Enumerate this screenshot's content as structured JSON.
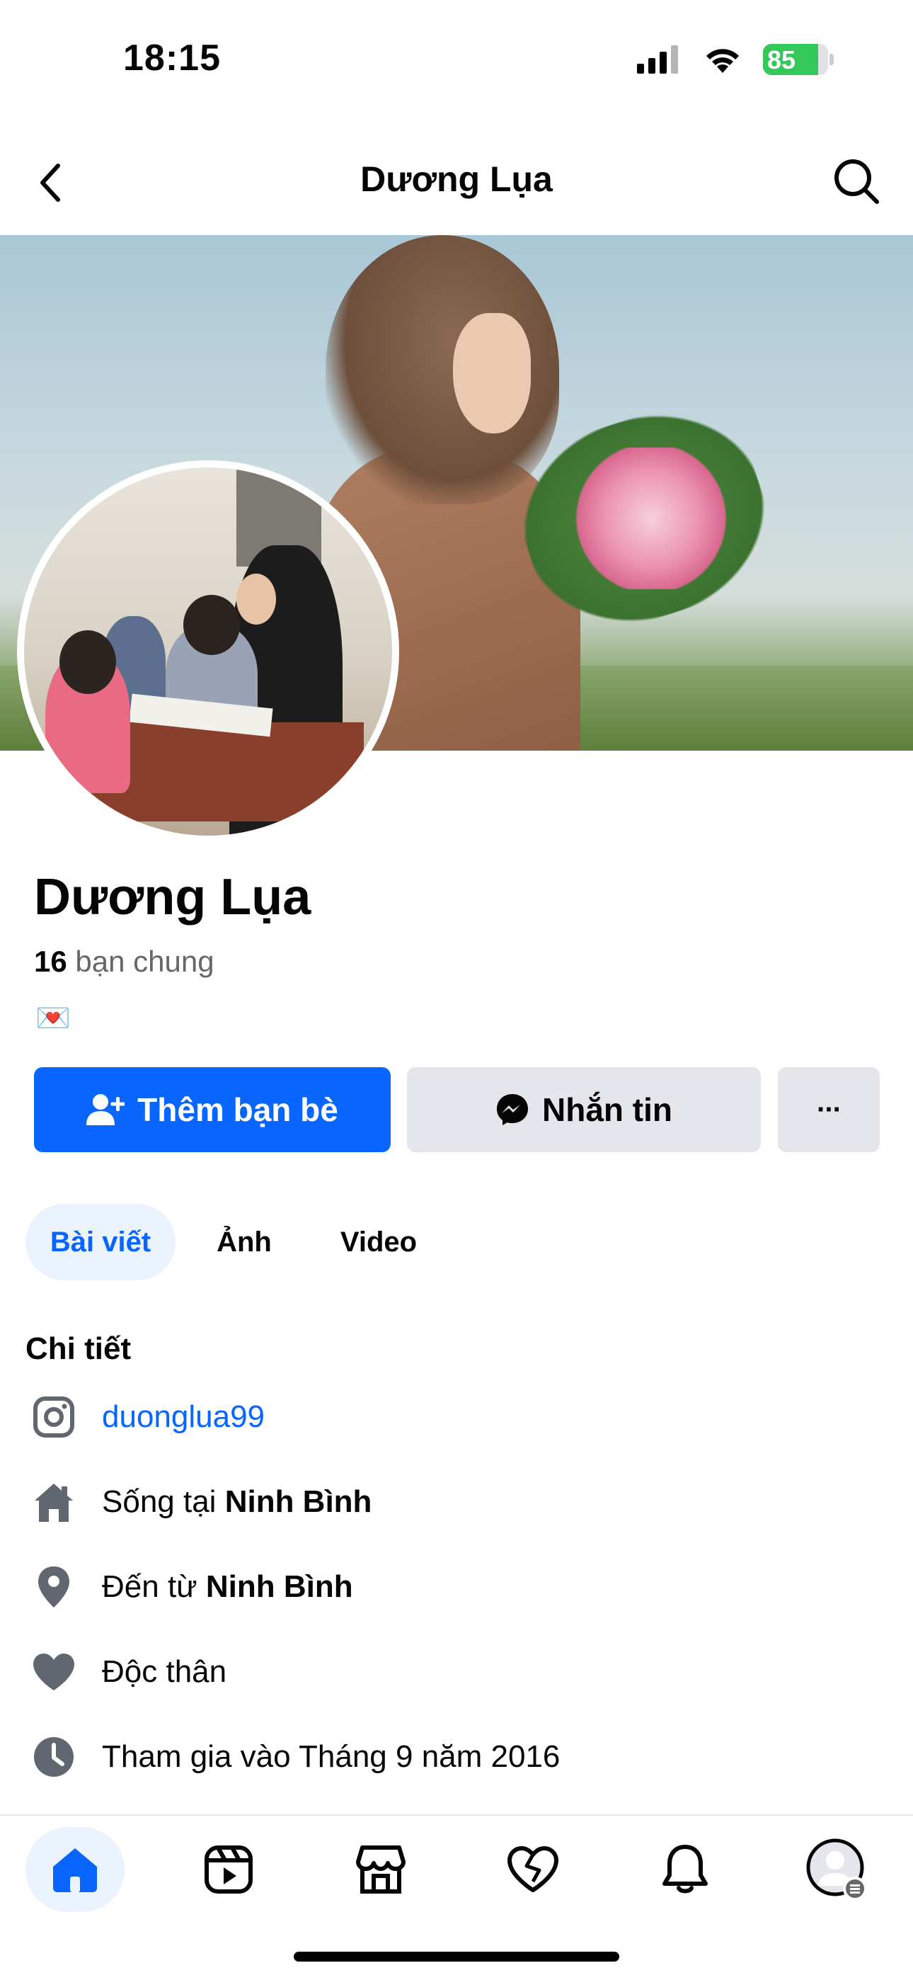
{
  "status_bar": {
    "time": "18:15",
    "battery": "85",
    "battery_level": 0.85,
    "icons": [
      "cellular-signal-icon",
      "wifi-icon",
      "battery-charging-icon"
    ]
  },
  "header": {
    "title": "Dương Lụa",
    "back_icon": "chevron-left-icon",
    "search_icon": "search-icon"
  },
  "profile": {
    "name": "Dương Lụa",
    "mutual_count": "16",
    "mutual_label": "bạn chung",
    "bio": "💌"
  },
  "actions": {
    "add_friend": "Thêm bạn bè",
    "message": "Nhắn tin",
    "more": "···"
  },
  "tabs": [
    {
      "label": "Bài viết",
      "active": true
    },
    {
      "label": "Ảnh",
      "active": false
    },
    {
      "label": "Video",
      "active": false
    }
  ],
  "details": {
    "title": "Chi tiết",
    "instagram": "duonglua99",
    "lives_prefix": "Sống tại ",
    "lives_place": "Ninh Bình",
    "from_prefix": "Đến từ ",
    "from_place": "Ninh Bình",
    "relationship": "Độc thân",
    "joined": "Tham gia vào Tháng 9 năm 2016"
  },
  "bottom_nav": {
    "items": [
      "home-icon",
      "reels-icon",
      "marketplace-icon",
      "dating-icon",
      "notifications-icon",
      "profile-menu-icon"
    ],
    "active": "home-icon"
  },
  "colors": {
    "primary": "#0866ff",
    "secondary_button": "#e4e6eb",
    "active_tab_bg": "#ebf3ff",
    "muted_text": "#65676b",
    "battery_green": "#34c759"
  }
}
